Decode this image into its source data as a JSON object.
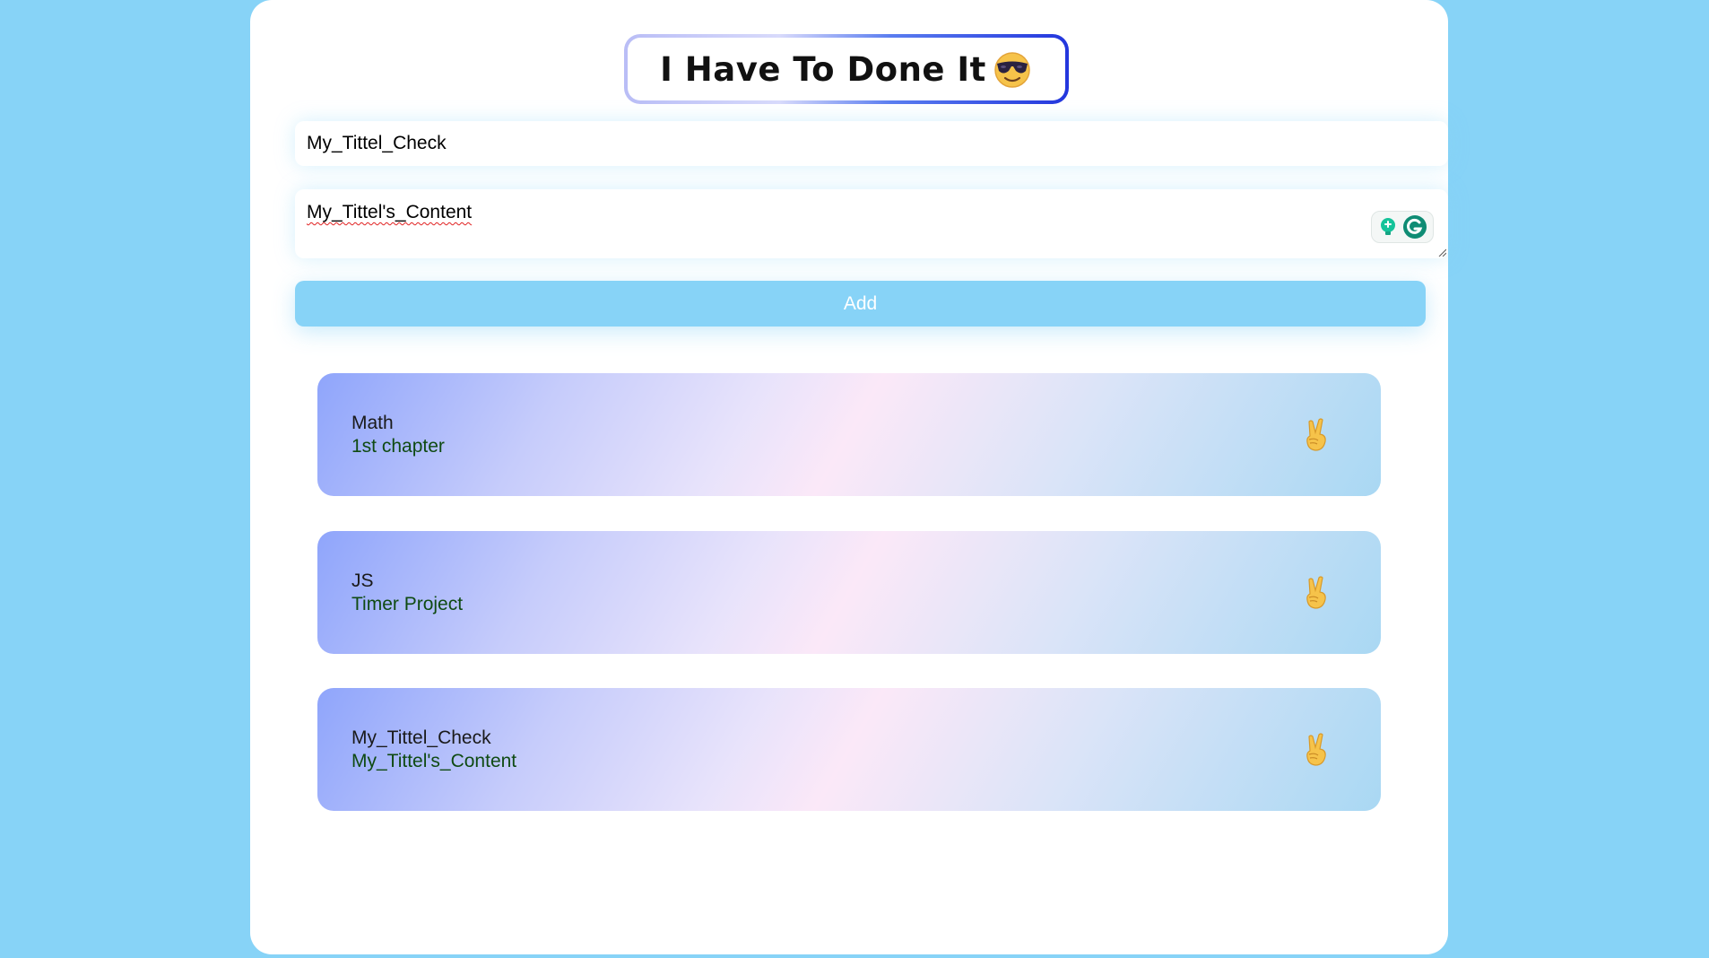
{
  "header": {
    "title": "I Have To Done It",
    "icon": "smiling-face-with-sunglasses-icon"
  },
  "form": {
    "title_value": "My_Tittel_Check",
    "content_value": "My_Tittel's_Content",
    "add_label": "Add"
  },
  "notes": [
    {
      "title": "Math",
      "content": "1st chapter",
      "icon": "victory-hand-icon"
    },
    {
      "title": "JS",
      "content": "Timer Project",
      "icon": "victory-hand-icon"
    },
    {
      "title": "My_Tittel_Check",
      "content": "My_Tittel's_Content",
      "icon": "victory-hand-icon"
    }
  ],
  "colors": {
    "page_background": "#87d3f7",
    "add_button": "#87d3f7",
    "note_title": "#1a1a1a",
    "note_content": "#0f4a12"
  }
}
